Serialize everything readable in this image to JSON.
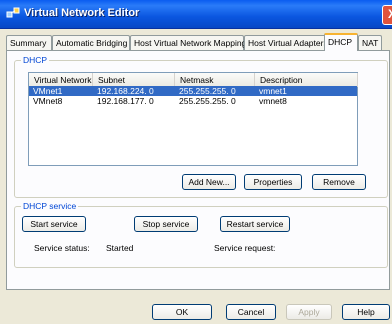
{
  "window": {
    "title": "Virtual Network Editor",
    "close_symbol": "X"
  },
  "tabs": [
    "Summary",
    "Automatic Bridging",
    "Host Virtual Network Mapping",
    "Host Virtual Adapters",
    "DHCP",
    "NAT"
  ],
  "dhcp": {
    "group_label": "DHCP",
    "columns": [
      "Virtual Network",
      "Subnet",
      "Netmask",
      "Description"
    ],
    "rows": [
      {
        "network": "VMnet1",
        "subnet": "192.168.224.  0",
        "netmask": "255.255.255.  0",
        "description": "vmnet1"
      },
      {
        "network": "VMnet8",
        "subnet": "192.168.177.  0",
        "netmask": "255.255.255.  0",
        "description": "vmnet8"
      }
    ],
    "buttons": {
      "add": "Add New...",
      "properties": "Properties",
      "remove": "Remove"
    }
  },
  "service": {
    "group_label": "DHCP service",
    "buttons": {
      "start": "Start service",
      "stop": "Stop service",
      "restart": "Restart service"
    },
    "status_label": "Service status:",
    "status_value": "Started",
    "request_label": "Service request:"
  },
  "footer": {
    "ok": "OK",
    "cancel": "Cancel",
    "apply": "Apply",
    "help": "Help"
  }
}
